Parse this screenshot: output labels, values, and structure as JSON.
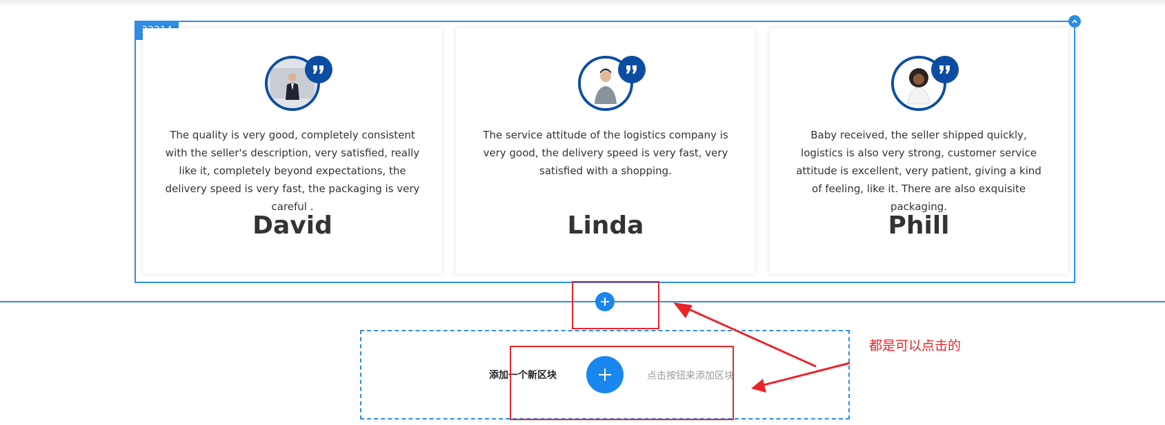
{
  "block": {
    "id_label": "33314"
  },
  "testimonials": [
    {
      "quote": "The quality is very good, completely consistent with the seller's description, very satisfied, really like it, completely beyond expectations, the delivery speed is very fast, the packaging is very careful .",
      "name": "David"
    },
    {
      "quote": "The service attitude of the logistics company is very good, the delivery speed is very fast, very satisfied with a shopping.",
      "name": "Linda"
    },
    {
      "quote": "Baby received, the seller shipped quickly, logistics is also very strong, customer service attitude is excellent, very patient, giving a kind of feeling, like it. There are also exquisite packaging.",
      "name": "Phill"
    }
  ],
  "add_block": {
    "title": "添加一个新区块",
    "hint": "点击按钮来添加区块"
  },
  "annotation": {
    "text": "都是可以点击的"
  },
  "colors": {
    "accent": "#2d8ce4",
    "avatar_ring": "#0c4da2",
    "add_button": "#1a86f0",
    "annotation_red": "#e8262a"
  },
  "icons": {
    "quote_badge": "quote-icon",
    "add": "plus-icon",
    "collapse": "chevron-up-icon"
  }
}
